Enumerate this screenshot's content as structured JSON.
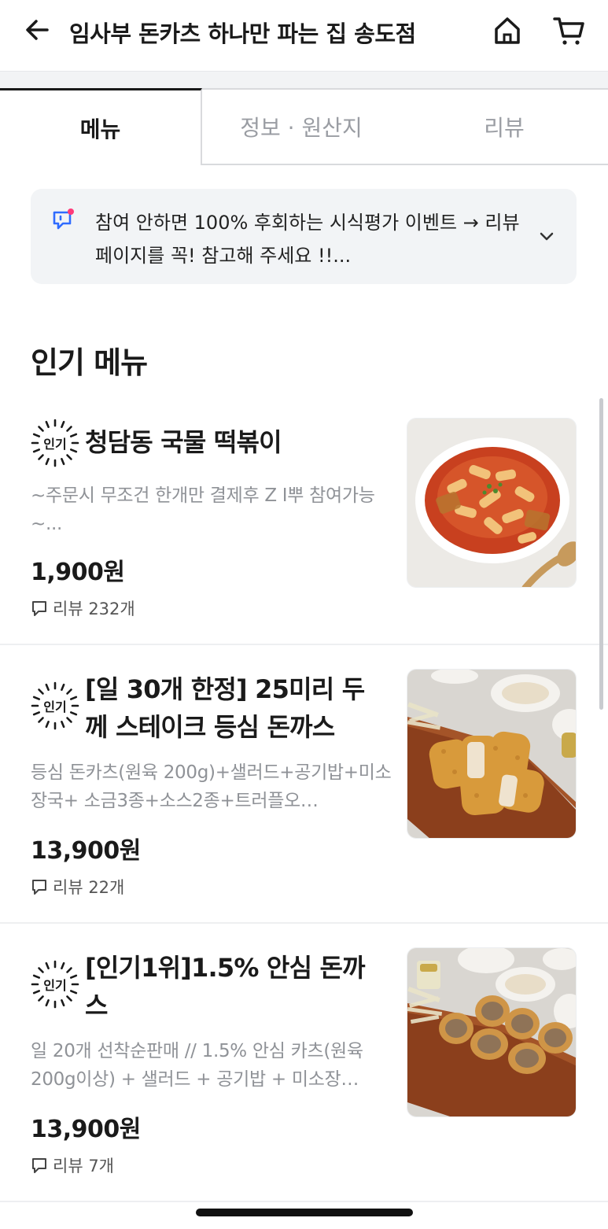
{
  "header": {
    "title": "임사부 돈카츠 하나만 파는 집 송도점",
    "back_icon": "arrow-left-icon",
    "home_icon": "home-icon",
    "cart_icon": "cart-icon"
  },
  "tabs": [
    {
      "label": "메뉴",
      "active": true
    },
    {
      "label": "정보 · 원산지",
      "active": false
    },
    {
      "label": "리뷰",
      "active": false
    }
  ],
  "notice": {
    "text": "참여 안하면 100% 후회하는 시식평가 이벤트 → 리뷰 페이지를 꼭! 참고해 주세요 !!...",
    "icon": "message-icon",
    "expand_icon": "chevron-down-icon"
  },
  "section": {
    "title": "인기 메뉴"
  },
  "menu_items": [
    {
      "badge": "인기",
      "name": "청담동 국물 떡볶이",
      "description": "~주문시 무조건 한개만  결제후 Z I뿌 참여가능~...",
      "price": "1,900원",
      "review": "리뷰 232개"
    },
    {
      "badge": "인기",
      "name": "[일 30개 한정] 25미리 두께 스테이크 등심 돈까스",
      "description": "등심 돈카츠(원육 200g)+샐러드+공기밥+미소장국+ 소금3종+소스2종+트러플오…",
      "price": "13,900원",
      "review": "리뷰 22개"
    },
    {
      "badge": "인기",
      "name": "[인기1위]1.5% 안심 돈까스",
      "description": "일 20개 선착순판매 // 1.5% 안심 카츠(원육 200g이상) + 샐러드 + 공기밥 + 미소장…",
      "price": "13,900원",
      "review": "리뷰 7개"
    }
  ],
  "colors": {
    "accent": "#2f6bff",
    "notice_bg": "#f2f4f6",
    "dot": "#ff3b7a"
  }
}
